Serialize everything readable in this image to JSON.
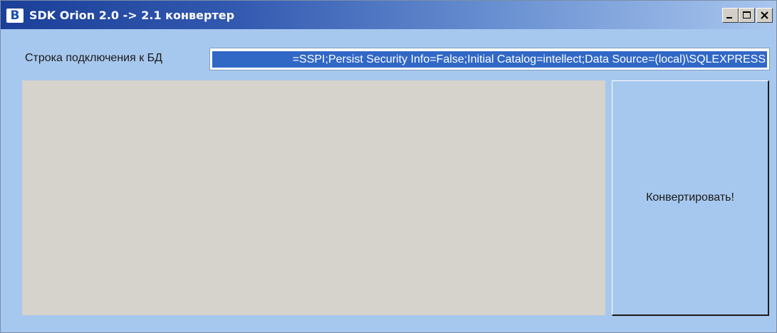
{
  "window": {
    "title": "SDK Orion 2.0 -> 2.1 конвертер",
    "icon_letter": "B",
    "controls": [
      "minimize-icon",
      "maximize-icon",
      "close-icon"
    ]
  },
  "form": {
    "connection_label": "Строка подключения к БД",
    "connection_value": "=SSPI;Persist Security Info=False;Initial Catalog=intellect;Data Source=(local)\\SQLEXPRESS",
    "log_text": "",
    "convert_button_label": "Конвертировать!"
  },
  "colors": {
    "window_background": "#a7c8ee",
    "title_gradient_start": "#1b3f98",
    "selection": "#3168c6",
    "log_panel": "#d6d2cc"
  }
}
